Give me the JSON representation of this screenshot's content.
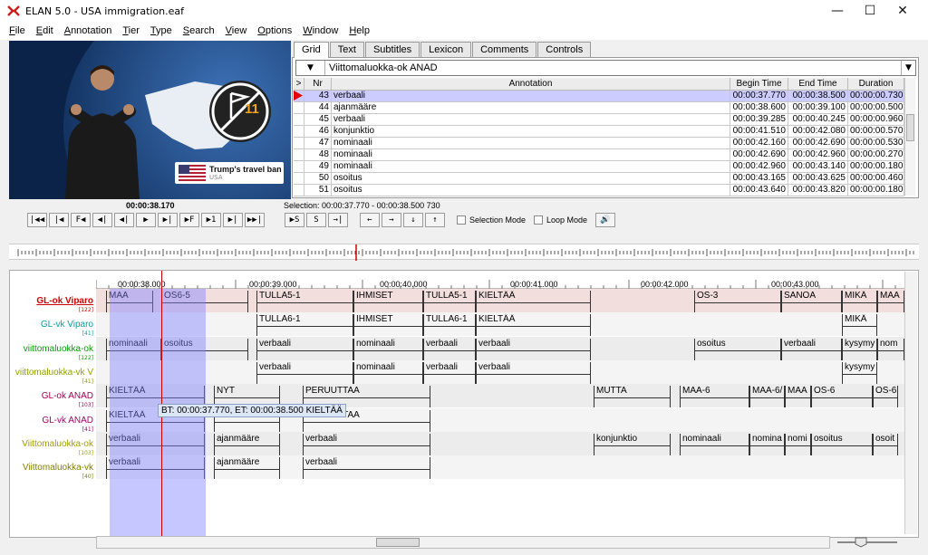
{
  "window": {
    "title": "ELAN 5.0 - USA immigration.eaf",
    "min": "—",
    "max": "☐",
    "close": "✕"
  },
  "menu": [
    {
      "mn": "F",
      "rest": "ile"
    },
    {
      "mn": "E",
      "rest": "dit"
    },
    {
      "mn": "A",
      "rest": "nnotation"
    },
    {
      "mn": "T",
      "rest": "ier"
    },
    {
      "mn": "T",
      "rest": "ype"
    },
    {
      "mn": "S",
      "rest": "earch"
    },
    {
      "mn": "V",
      "rest": "iew"
    },
    {
      "mn": "O",
      "rest": "ptions"
    },
    {
      "mn": "W",
      "rest": "indow"
    },
    {
      "mn": "H",
      "rest": "elp"
    }
  ],
  "video": {
    "badge_title": "Trump's travel ban",
    "badge_sub": "USA",
    "number": "11"
  },
  "tabs": [
    "Grid",
    "Text",
    "Subtitles",
    "Lexicon",
    "Comments",
    "Controls"
  ],
  "tier_select": {
    "value": "Viittomaluokka-ok ANAD",
    "left_arrow": "▼",
    "right_arrow": "▼"
  },
  "grid": {
    "headers": [
      ">",
      "Nr",
      "Annotation",
      "Begin Time",
      "End Time",
      "Duration"
    ],
    "rows": [
      {
        "nr": "43",
        "annotation": "verbaali",
        "begin": "00:00:37.770",
        "end": "00:00:38.500",
        "duration": "00:00:00.730"
      },
      {
        "nr": "44",
        "annotation": "ajanmääre",
        "begin": "00:00:38.600",
        "end": "00:00:39.100",
        "duration": "00:00:00.500"
      },
      {
        "nr": "45",
        "annotation": "verbaali",
        "begin": "00:00:39.285",
        "end": "00:00:40.245",
        "duration": "00:00:00.960"
      },
      {
        "nr": "46",
        "annotation": "konjunktio",
        "begin": "00:00:41.510",
        "end": "00:00:42.080",
        "duration": "00:00:00.570"
      },
      {
        "nr": "47",
        "annotation": "nominaali",
        "begin": "00:00:42.160",
        "end": "00:00:42.690",
        "duration": "00:00:00.530"
      },
      {
        "nr": "48",
        "annotation": "nominaali",
        "begin": "00:00:42.690",
        "end": "00:00:42.960",
        "duration": "00:00:00.270"
      },
      {
        "nr": "49",
        "annotation": "nominaali",
        "begin": "00:00:42.960",
        "end": "00:00:43.140",
        "duration": "00:00:00.180"
      },
      {
        "nr": "50",
        "annotation": "osoitus",
        "begin": "00:00:43.165",
        "end": "00:00:43.625",
        "duration": "00:00:00.460"
      },
      {
        "nr": "51",
        "annotation": "osoitus",
        "begin": "00:00:43.640",
        "end": "00:00:43.820",
        "duration": "00:00:00.180"
      }
    ]
  },
  "player": {
    "time": "00:00:38.170",
    "selection": "Selection: 00:00:37.770 - 00:00:38.500  730",
    "controls_1": [
      "|◀◀",
      "|◀",
      "F◀",
      "◀|",
      "◀|",
      "▶",
      "▶|",
      "▶F",
      "▶1",
      "▶|",
      "▶▶|"
    ],
    "controls_2": [
      "▶S",
      "S",
      "→|"
    ],
    "controls_3": [
      "←",
      "→",
      "↓",
      "↑"
    ],
    "selection_mode": "Selection Mode",
    "loop_mode": "Loop Mode",
    "volume": "🔊"
  },
  "ruler": [
    "00:00:38.000",
    "00:00:39.000",
    "00:00:40.000",
    "00:00:41.000",
    "00:00:42.000",
    "00:00:43.000"
  ],
  "tiers": [
    {
      "name": "GL-ok Viparo",
      "count": "[122]",
      "color": "#cc0000",
      "active": true,
      "anns": [
        [
          11,
          63,
          "MAA"
        ],
        [
          72,
          168,
          "OS6-5"
        ],
        [
          177,
          284,
          "TULLA5-1"
        ],
        [
          284,
          361,
          "IHMISET"
        ],
        [
          361,
          419,
          "TULLA5-1"
        ],
        [
          419,
          546,
          "KIELTÄÄ"
        ],
        [
          660,
          756,
          "OS-3"
        ],
        [
          756,
          823,
          "SANOA"
        ],
        [
          823,
          862,
          "MIKÄ"
        ],
        [
          862,
          892,
          "MAA"
        ]
      ]
    },
    {
      "name": "GL-vk Viparo",
      "count": "[41]",
      "color": "#00a0a0",
      "anns": [
        [
          177,
          284,
          "TULLA6-1"
        ],
        [
          284,
          361,
          "IHMISET"
        ],
        [
          361,
          419,
          "TULLA6-1"
        ],
        [
          419,
          546,
          "KIELTÄÄ"
        ],
        [
          823,
          862,
          "MIKÄ"
        ]
      ]
    },
    {
      "name": "viittomaluokka-ok",
      "count": "[122]",
      "color": "#00a000",
      "anns": [
        [
          11,
          72,
          "nominaali"
        ],
        [
          72,
          168,
          "osoitus"
        ],
        [
          177,
          284,
          "verbaali"
        ],
        [
          284,
          361,
          "nominaali"
        ],
        [
          361,
          419,
          "verbaali"
        ],
        [
          419,
          546,
          "verbaali"
        ],
        [
          660,
          756,
          "osoitus"
        ],
        [
          756,
          823,
          "verbaali"
        ],
        [
          823,
          862,
          "kysymy"
        ],
        [
          862,
          892,
          "nom"
        ]
      ]
    },
    {
      "name": "viittomaluokka-vk V",
      "count": "[41]",
      "color": "#90a000",
      "anns": [
        [
          177,
          284,
          "verbaali"
        ],
        [
          284,
          361,
          "nominaali"
        ],
        [
          361,
          419,
          "verbaali"
        ],
        [
          419,
          546,
          "verbaali"
        ],
        [
          823,
          862,
          "kysymy"
        ]
      ]
    },
    {
      "name": "GL-ok ANAD",
      "count": "[103]",
      "color": "#a00050",
      "anns": [
        [
          11,
          120,
          "KIELTÄÄ"
        ],
        [
          130,
          203,
          "NYT"
        ],
        [
          228,
          369,
          "PERUUTTAA"
        ],
        [
          549,
          634,
          "MUTTA"
        ],
        [
          644,
          721,
          "MAA-6"
        ],
        [
          721,
          760,
          "MAA-6/"
        ],
        [
          760,
          789,
          "MAA"
        ],
        [
          789,
          857,
          "OS-6"
        ],
        [
          857,
          885,
          "OS-6"
        ]
      ]
    },
    {
      "name": "GL-vk ANAD",
      "count": "[41]",
      "color": "#a0006a",
      "anns": [
        [
          11,
          120,
          "KIELTÄÄ"
        ],
        [
          130,
          203,
          ""
        ],
        [
          228,
          369,
          "PERUUTTAA"
        ]
      ]
    },
    {
      "name": "Viittomaluokka-ok",
      "count": "[103]",
      "color": "#a0a000",
      "anns": [
        [
          11,
          120,
          "verbaali"
        ],
        [
          130,
          203,
          "ajanmääre"
        ],
        [
          228,
          369,
          "verbaali"
        ],
        [
          549,
          634,
          "konjunktio"
        ],
        [
          644,
          721,
          "nominaali"
        ],
        [
          721,
          760,
          "nomina"
        ],
        [
          760,
          789,
          "nomi"
        ],
        [
          789,
          857,
          "osoitus"
        ],
        [
          857,
          885,
          "osoit"
        ]
      ]
    },
    {
      "name": "Viittomaluokka-vk",
      "count": "[40]",
      "color": "#808000",
      "anns": [
        [
          11,
          120,
          "verbaali"
        ],
        [
          130,
          203,
          "ajanmääre"
        ],
        [
          228,
          369,
          "verbaali"
        ]
      ]
    }
  ],
  "tooltip": "BT: 00:00:37.770, ET: 00:00:38.500 KIELTÄÄ"
}
